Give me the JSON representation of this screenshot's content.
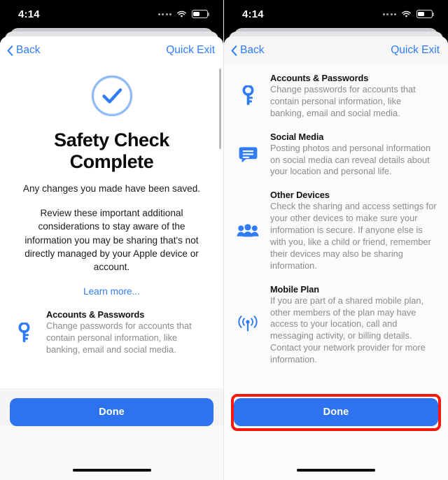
{
  "status_bar": {
    "time": "4:14",
    "signal_icon": "signal-dots-icon",
    "wifi_icon": "wifi-icon",
    "battery_icon": "battery-icon",
    "battery_level_pct": 46
  },
  "colors": {
    "accent_blue": "#2f7cf6",
    "button_blue": "#2f72ef",
    "annotation_red": "#f41b0e",
    "ring_blue": "#8fb9f7",
    "body_gray": "#8b8b90"
  },
  "nav": {
    "back_label": "Back",
    "back_icon": "chevron-left-icon",
    "quick_exit_label": "Quick Exit"
  },
  "left_panel": {
    "check_icon": "check-circle-icon",
    "title": "Safety Check Complete",
    "subtitle": "Any changes you made have been saved.",
    "paragraph": "Review these important additional considerations to stay aware of the information you may be sharing that's not directly managed by your Apple device or account.",
    "learn_more_label": "Learn more...",
    "items": [
      {
        "icon": "key-icon",
        "heading": "Accounts & Passwords",
        "body": "Change passwords for accounts that contain personal information, like banking, email and social media."
      }
    ],
    "done_label": "Done"
  },
  "right_panel": {
    "items": [
      {
        "icon": "key-icon",
        "heading": "Accounts & Passwords",
        "body": "Change passwords for accounts that contain personal information, like banking, email and social media."
      },
      {
        "icon": "message-bubble-icon",
        "heading": "Social Media",
        "body": "Posting photos and personal information on social media can reveal details about your location and personal life."
      },
      {
        "icon": "people-group-icon",
        "heading": "Other Devices",
        "body": "Check the sharing and access settings for your other devices to make sure your information is secure. If anyone else is with you, like a child or friend, remember their devices may also be sharing information."
      },
      {
        "icon": "broadcast-antenna-icon",
        "heading": "Mobile Plan",
        "body": "If you are part of a shared mobile plan, other members of the plan may have access to your location, call and messaging activity, or billing details. Contact your network provider for more information."
      }
    ],
    "done_label": "Done"
  }
}
